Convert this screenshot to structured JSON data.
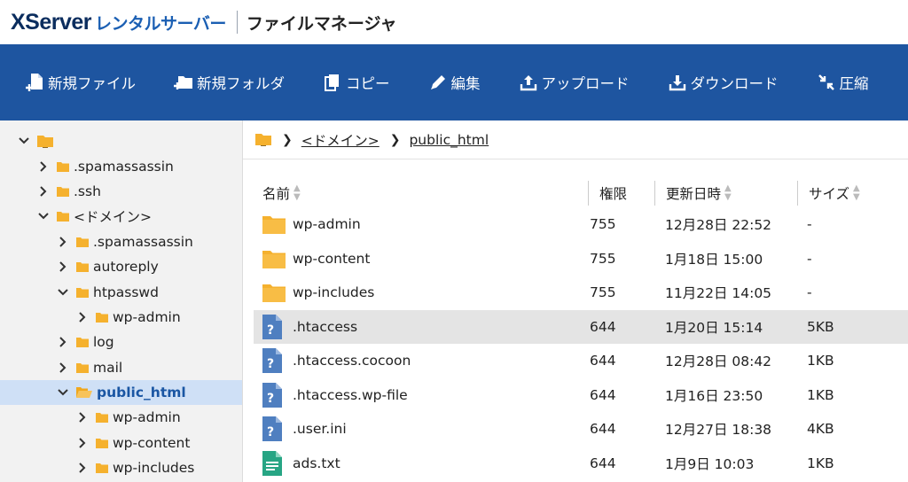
{
  "header": {
    "logo_main": "XServer",
    "logo_sub": "レンタルサーバー",
    "title": "ファイルマネージャ"
  },
  "toolbar": {
    "new_file": "新規ファイル",
    "new_folder": "新規フォルダ",
    "copy": "コピー",
    "edit": "編集",
    "upload": "アップロード",
    "download": "ダウンロード",
    "compress": "圧縮"
  },
  "tree": {
    "items": [
      {
        "label": "",
        "depth": 0,
        "expanded": true
      },
      {
        "label": ".spamassassin",
        "depth": 1,
        "expanded": false
      },
      {
        "label": ".ssh",
        "depth": 1,
        "expanded": false
      },
      {
        "label": "<ドメイン>",
        "depth": 1,
        "expanded": true
      },
      {
        "label": ".spamassassin",
        "depth": 2,
        "expanded": false
      },
      {
        "label": "autoreply",
        "depth": 2,
        "expanded": false
      },
      {
        "label": "htpasswd",
        "depth": 2,
        "expanded": true
      },
      {
        "label": "wp-admin",
        "depth": 3,
        "expanded": false
      },
      {
        "label": "log",
        "depth": 2,
        "expanded": false
      },
      {
        "label": "mail",
        "depth": 2,
        "expanded": false
      },
      {
        "label": "public_html",
        "depth": 2,
        "expanded": true,
        "selected": true
      },
      {
        "label": "wp-admin",
        "depth": 3,
        "expanded": false
      },
      {
        "label": "wp-content",
        "depth": 3,
        "expanded": false
      },
      {
        "label": "wp-includes",
        "depth": 3,
        "expanded": false
      }
    ]
  },
  "breadcrumb": {
    "domain": "<ドメイン>",
    "folder": "public_html"
  },
  "table": {
    "headers": {
      "name": "名前",
      "perm": "権限",
      "date": "更新日時",
      "size": "サイズ"
    },
    "rows": [
      {
        "type": "folder",
        "name": "wp-admin",
        "perm": "755",
        "date": "12月28日 22:52",
        "size": "-"
      },
      {
        "type": "folder",
        "name": "wp-content",
        "perm": "755",
        "date": "1月18日 15:00",
        "size": "-"
      },
      {
        "type": "folder",
        "name": "wp-includes",
        "perm": "755",
        "date": "11月22日 14:05",
        "size": "-"
      },
      {
        "type": "unknown",
        "name": ".htaccess",
        "perm": "644",
        "date": "1月20日 15:14",
        "size": "5KB",
        "highlight": true
      },
      {
        "type": "unknown",
        "name": ".htaccess.cocoon",
        "perm": "644",
        "date": "12月28日 08:42",
        "size": "1KB"
      },
      {
        "type": "unknown",
        "name": ".htaccess.wp-file",
        "perm": "644",
        "date": "1月16日 23:50",
        "size": "1KB"
      },
      {
        "type": "unknown",
        "name": ".user.ini",
        "perm": "644",
        "date": "12月27日 18:38",
        "size": "4KB"
      },
      {
        "type": "text",
        "name": "ads.txt",
        "perm": "644",
        "date": "1月9日 10:03",
        "size": "1KB"
      }
    ]
  },
  "colors": {
    "toolbar_bg": "#1e55a0",
    "folder": "#f5b12e",
    "selected_bg": "#cfe0f6",
    "file_unknown": "#4f7fc0",
    "file_text": "#27a584"
  }
}
